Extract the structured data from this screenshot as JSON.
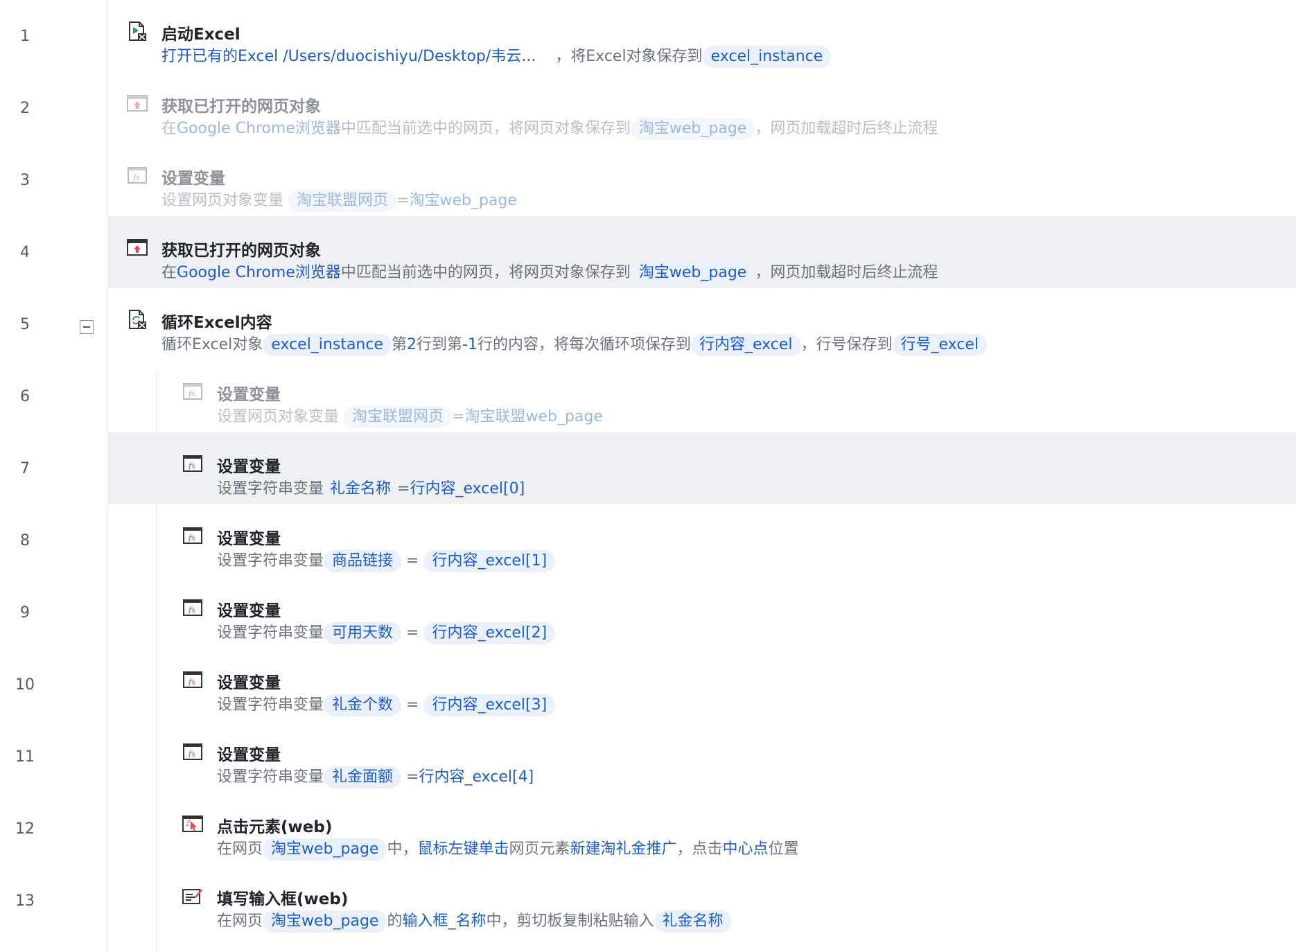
{
  "lines": [
    "1",
    "2",
    "3",
    "4",
    "5",
    "6",
    "7",
    "8",
    "9",
    "10",
    "11",
    "12",
    "13"
  ],
  "steps": [
    {
      "title": "启动Excel",
      "desc": {
        "a": "打开已有的Excel /Users/duocishiyu/Desktop/韦云...",
        "b": "，将Excel对象保存到",
        "c": "excel_instance"
      }
    },
    {
      "title": "获取已打开的网页对象",
      "desc": {
        "a": "在",
        "b": "Google Chrome浏览器",
        "c": "中匹配当前选中的网页，将网页对象保存到",
        "d": "淘宝web_page",
        "e": "，网页加载超时后终止流程"
      }
    },
    {
      "title": "设置变量",
      "desc": {
        "a": "设置网页对象变量",
        "b": "淘宝联盟网页",
        "c": "=",
        "d": "淘宝web_page"
      }
    },
    {
      "title": "获取已打开的网页对象",
      "desc": {
        "a": "在",
        "b": "Google Chrome浏览器",
        "c": "中匹配当前选中的网页，将网页对象保存到",
        "d": "淘宝web_page",
        "e": "，网页加载超时后终止流程"
      }
    },
    {
      "title": "循环Excel内容",
      "desc": {
        "a": "循环Excel对象",
        "b": "excel_instance",
        "c": "第",
        "d": "2",
        "e": "行到第",
        "f": "-1",
        "g": "行的内容，将每次循环项保存到",
        "h": "行内容_excel",
        "i": "，行号保存到",
        "j": "行号_excel"
      }
    },
    {
      "title": "设置变量",
      "desc": {
        "a": "设置网页对象变量",
        "b": "淘宝联盟网页",
        "c": "=",
        "d": "淘宝联盟web_page"
      }
    },
    {
      "title": "设置变量",
      "desc": {
        "a": "设置字符串变量",
        "b": "礼金名称",
        "c": "=",
        "d": "行内容_excel[0]"
      }
    },
    {
      "title": "设置变量",
      "desc": {
        "a": "设置字符串变量",
        "b": "商品链接",
        "c": "=",
        "d": "行内容_excel[1]"
      }
    },
    {
      "title": "设置变量",
      "desc": {
        "a": "设置字符串变量",
        "b": "可用天数",
        "c": "=",
        "d": "行内容_excel[2]"
      }
    },
    {
      "title": "设置变量",
      "desc": {
        "a": "设置字符串变量",
        "b": "礼金个数",
        "c": "=",
        "d": "行内容_excel[3]"
      }
    },
    {
      "title": "设置变量",
      "desc": {
        "a": "设置字符串变量",
        "b": "礼金面额",
        "c": "=",
        "d": "行内容_excel[4]"
      }
    },
    {
      "title": "点击元素(web)",
      "desc": {
        "a": "在网页",
        "b": "淘宝web_page",
        "c": "中，",
        "d": "鼠标左键单击",
        "e": "网页元素",
        "f": "新建淘礼金推广",
        "g": "，点击",
        "h": "中心点",
        "i": "位置"
      }
    },
    {
      "title": "填写输入框(web)",
      "desc": {
        "a": "在网页",
        "b": "淘宝web_page",
        "c": "的",
        "d": "输入框_名称",
        "e": "中，剪切板复制粘贴输入",
        "f": "礼金名称"
      }
    }
  ],
  "icons": {
    "excel": "excel-launch-icon",
    "web_page": "web-page-icon",
    "variable": "fx-variable-icon",
    "loop": "excel-loop-icon",
    "click": "click-element-icon",
    "input": "fill-input-icon"
  },
  "colors": {
    "link": "#1a5bd6",
    "tag_bg": "#eaf1fd",
    "selected_row": "#eef0f4",
    "icon_red": "#e5484d"
  }
}
